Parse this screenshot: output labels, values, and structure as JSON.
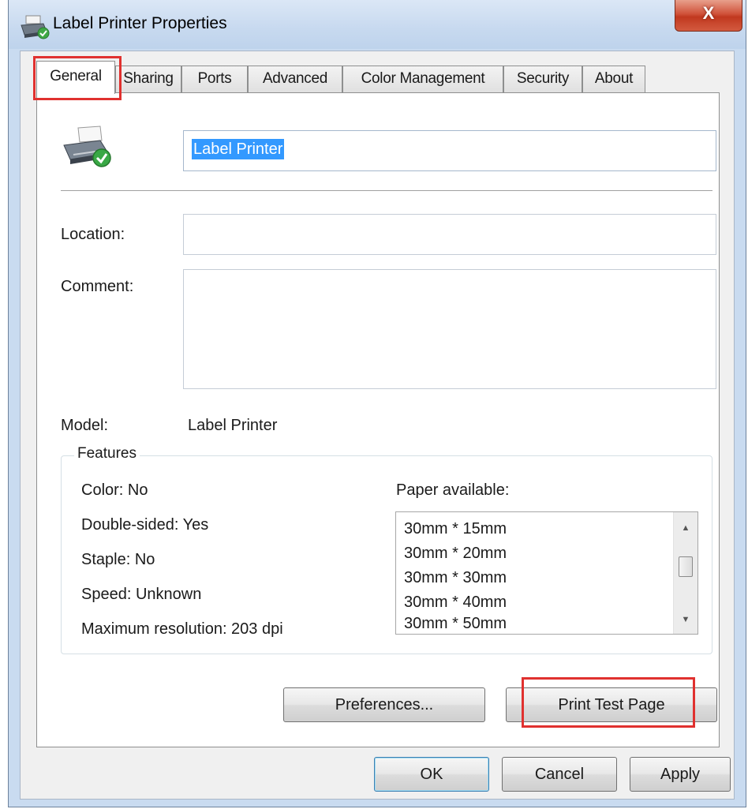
{
  "window": {
    "title": "Label Printer Properties",
    "close_label": "X"
  },
  "tabs": [
    {
      "label": "General",
      "active": true
    },
    {
      "label": "Sharing"
    },
    {
      "label": "Ports"
    },
    {
      "label": "Advanced"
    },
    {
      "label": "Color Management"
    },
    {
      "label": "Security"
    },
    {
      "label": "About"
    }
  ],
  "general": {
    "printer_name": "Label Printer",
    "location_label": "Location:",
    "location_value": "",
    "comment_label": "Comment:",
    "comment_value": "",
    "model_label": "Model:",
    "model_value": "Label Printer"
  },
  "features": {
    "legend": "Features",
    "color": "Color: No",
    "double_sided": "Double-sided: Yes",
    "staple": "Staple: No",
    "speed": "Speed: Unknown",
    "max_resolution": "Maximum resolution: 203 dpi",
    "paper_label": "Paper available:",
    "paper_sizes": [
      "30mm * 15mm",
      "30mm * 20mm",
      "30mm * 30mm",
      "30mm * 40mm",
      "30mm * 50mm"
    ]
  },
  "buttons": {
    "preferences": "Preferences...",
    "print_test_page": "Print Test Page",
    "ok": "OK",
    "cancel": "Cancel",
    "apply": "Apply"
  },
  "colors": {
    "highlight_outline": "#e0312f",
    "selection": "#3399ff"
  },
  "icons": {
    "title": "printer-icon",
    "main": "printer-ready-icon"
  }
}
